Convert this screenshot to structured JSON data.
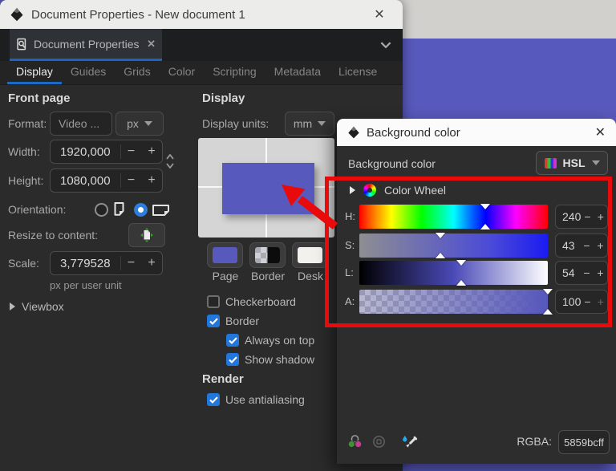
{
  "window": {
    "title": "Document Properties - New document 1",
    "close_glyph": "✕"
  },
  "dock": {
    "tab_label": "Document Properties",
    "tab_close_glyph": "✕"
  },
  "tabs": {
    "items": [
      "Display",
      "Guides",
      "Grids",
      "Color",
      "Scripting",
      "Metadata",
      "License"
    ],
    "active": "Display"
  },
  "glyphs": {
    "minus": "−",
    "plus": "+"
  },
  "front_page": {
    "heading": "Front page",
    "format_label": "Format:",
    "format_value": "Video ...",
    "unit_value": "px",
    "width_label": "Width:",
    "width_value": "1920,000",
    "height_label": "Height:",
    "height_value": "1080,000",
    "orientation_label": "Orientation:",
    "resize_label": "Resize to content:",
    "scale_label": "Scale:",
    "scale_value": "3,779528",
    "scale_hint": "px per user unit",
    "viewbox_label": "Viewbox"
  },
  "display": {
    "heading": "Display",
    "units_label": "Display units:",
    "units_value": "mm",
    "swatch_labels": [
      "Page",
      "Border",
      "Desk"
    ],
    "checkerboard_label": "Checkerboard",
    "border_label": "Border",
    "always_label": "Always on top",
    "shadow_label": "Show shadow",
    "render_heading": "Render",
    "antialias_label": "Use antialiasing",
    "checkbox_states": {
      "checkerboard": false,
      "border": true,
      "always_on_top": true,
      "show_shadow": true,
      "use_antialiasing": true
    }
  },
  "dialog": {
    "title": "Background color",
    "close_glyph": "✕",
    "label": "Background color",
    "mode": "HSL",
    "wheel_label": "Color Wheel",
    "sliders": [
      {
        "label": "H:",
        "value": "240",
        "pos": 66.7
      },
      {
        "label": "S:",
        "value": "43",
        "pos": 43
      },
      {
        "label": "L:",
        "value": "54",
        "pos": 54
      },
      {
        "label": "A:",
        "value": "100",
        "pos": 100
      }
    ],
    "rgba_label": "RGBA:",
    "rgba_value": "5859bcff"
  },
  "colors": {
    "page_purple": "#5859bc",
    "checkbox_blue": "#2277dd",
    "tab_underline_blue": "#1b6ac4",
    "annotation_red": "#e90b0b",
    "desk_color": "#f2f1ee"
  }
}
